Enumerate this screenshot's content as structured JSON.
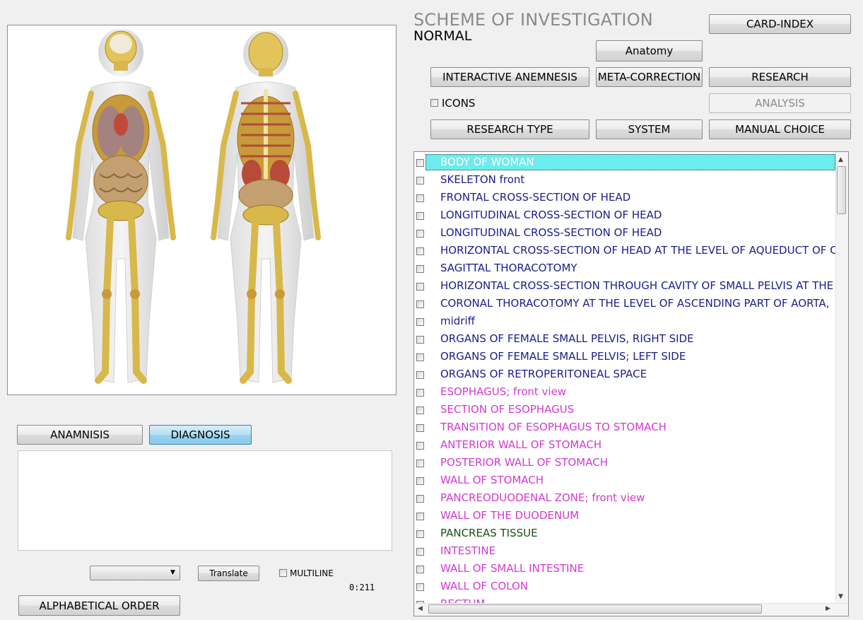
{
  "header": {
    "title": "SCHEME OF INVESTIGATION",
    "subtitle": "NORMAL"
  },
  "buttons": {
    "card_index": "CARD-INDEX",
    "anatomy": "Anatomy",
    "interactive_anemnesis": "INTERACTIVE ANEMNESIS",
    "meta_correction": "META-CORRECTION",
    "research": "RESEARCH",
    "analysis": "ANALYSIS",
    "research_type": "RESEARCH TYPE",
    "system": "SYSTEM",
    "manual_choice": "MANUAL CHOICE",
    "anamnisis": "ANAMNISIS",
    "diagnosis": "DIAGNOSIS",
    "translate": "Translate",
    "alphabetical_order": "ALPHABETICAL ORDER"
  },
  "icons_checkbox": {
    "label": "ICONS",
    "checked": false
  },
  "multiline_checkbox": {
    "label": "MULTILINE",
    "checked": false
  },
  "counter": "0:211",
  "language_select": {
    "value": ""
  },
  "notes": {
    "value": ""
  },
  "list": {
    "selected_index": 0,
    "items": [
      {
        "label": "BODY OF WOMAN",
        "color": "white"
      },
      {
        "label": "SKELETON front",
        "color": "blue"
      },
      {
        "label": "FRONTAL CROSS-SECTION OF HEAD",
        "color": "blue"
      },
      {
        "label": "LONGITUDINAL CROSS-SECTION OF HEAD",
        "color": "blue"
      },
      {
        "label": "LONGITUDINAL CROSS-SECTION OF HEAD",
        "color": "blue"
      },
      {
        "label": "HORIZONTAL CROSS-SECTION OF HEAD AT THE LEVEL OF AQUEDUCT OF C",
        "color": "blue"
      },
      {
        "label": "SAGITTAL THORACOTOMY",
        "color": "blue"
      },
      {
        "label": "HORIZONTAL CROSS-SECTION THROUGH CAVITY OF SMALL PELVIS AT THE",
        "color": "blue"
      },
      {
        "label": "CORONAL THORACOTOMY AT THE LEVEL OF ASCENDING PART OF AORTA,",
        "color": "blue"
      },
      {
        "label": "midriff",
        "color": "blue"
      },
      {
        "label": "ORGANS OF FEMALE SMALL PELVIS, RIGHT SIDE",
        "color": "blue"
      },
      {
        "label": "ORGANS OF FEMALE SMALL PELVIS; LEFT SIDE",
        "color": "blue"
      },
      {
        "label": "ORGANS OF RETROPERITONEAL SPACE",
        "color": "blue"
      },
      {
        "label": "ESOPHAGUS; front view",
        "color": "magenta"
      },
      {
        "label": "SECTION OF ESOPHAGUS",
        "color": "magenta"
      },
      {
        "label": "TRANSITION OF ESOPHAGUS TO STOMACH",
        "color": "magenta"
      },
      {
        "label": "ANTERIOR  WALL  OF  STOMACH",
        "color": "magenta"
      },
      {
        "label": "POSTERIOR WALL OF STOMACH",
        "color": "magenta"
      },
      {
        "label": "WALL OF STOMACH",
        "color": "magenta"
      },
      {
        "label": "PANCREODUODENAL ZONE; front view",
        "color": "magenta"
      },
      {
        "label": "WALL  OF  THE  DUODENUM",
        "color": "magenta"
      },
      {
        "label": "PANCREAS  TISSUE",
        "color": "green"
      },
      {
        "label": "INTESTINE",
        "color": "magenta"
      },
      {
        "label": "WALL  OF  SMALL  INTESTINE",
        "color": "magenta"
      },
      {
        "label": "WALL OF COLON",
        "color": "magenta"
      },
      {
        "label": "RECTUM",
        "color": "magenta"
      }
    ]
  },
  "colors": {
    "selection": "#6cecec",
    "blue": "#1c1c8c",
    "magenta": "#d23ad2",
    "green": "#1a4e1a",
    "active_button": "#9ad2ee"
  },
  "image": {
    "icons": [
      "female-anatomy-front-illustration",
      "female-anatomy-back-illustration"
    ]
  }
}
